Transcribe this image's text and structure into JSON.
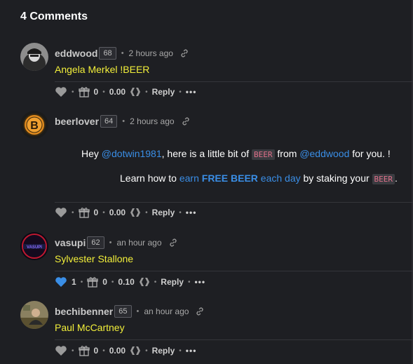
{
  "title": "4 Comments",
  "comments": [
    {
      "author": "eddwood",
      "reputation": "68",
      "time": "2 hours ago",
      "body": "Angela Merkel !BEER",
      "likes": "",
      "gifts": "0",
      "payout": "0.00",
      "reply": "Reply",
      "more": "•••"
    },
    {
      "author": "beerlover",
      "reputation": "64",
      "time": "2 hours ago",
      "line1": {
        "hey": "Hey ",
        "mention1": "@dotwin1981",
        "mid": ", here is a little bit of ",
        "tag": "BEER",
        "from": " from ",
        "mention2": "@eddwood",
        "end": " for you. !"
      },
      "line2": {
        "learn": "Learn how to ",
        "earn": "earn ",
        "free": "FREE BEER",
        "each": " each day",
        "staking": " by staking your ",
        "tag": "BEER",
        "end": "."
      },
      "gifts": "0",
      "payout": "0.00",
      "reply": "Reply",
      "more": "•••"
    },
    {
      "author": "vasupi",
      "reputation": "62",
      "time": "an hour ago",
      "body": "Sylvester Stallone",
      "likes": "1",
      "gifts": "0",
      "payout": "0.10",
      "reply": "Reply",
      "more": "•••"
    },
    {
      "author": "bechibenner",
      "reputation": "65",
      "time": "an hour ago",
      "body": "Paul McCartney",
      "gifts": "0",
      "payout": "0.00",
      "reply": "Reply",
      "more": "•••"
    }
  ],
  "colors": {
    "accent": "#3a8ee6",
    "highlight": "#f2ef3a",
    "background": "#1e1f23"
  },
  "icons": [
    "heart-icon",
    "gift-icon",
    "hive-icon",
    "link-icon",
    "more-icon"
  ]
}
